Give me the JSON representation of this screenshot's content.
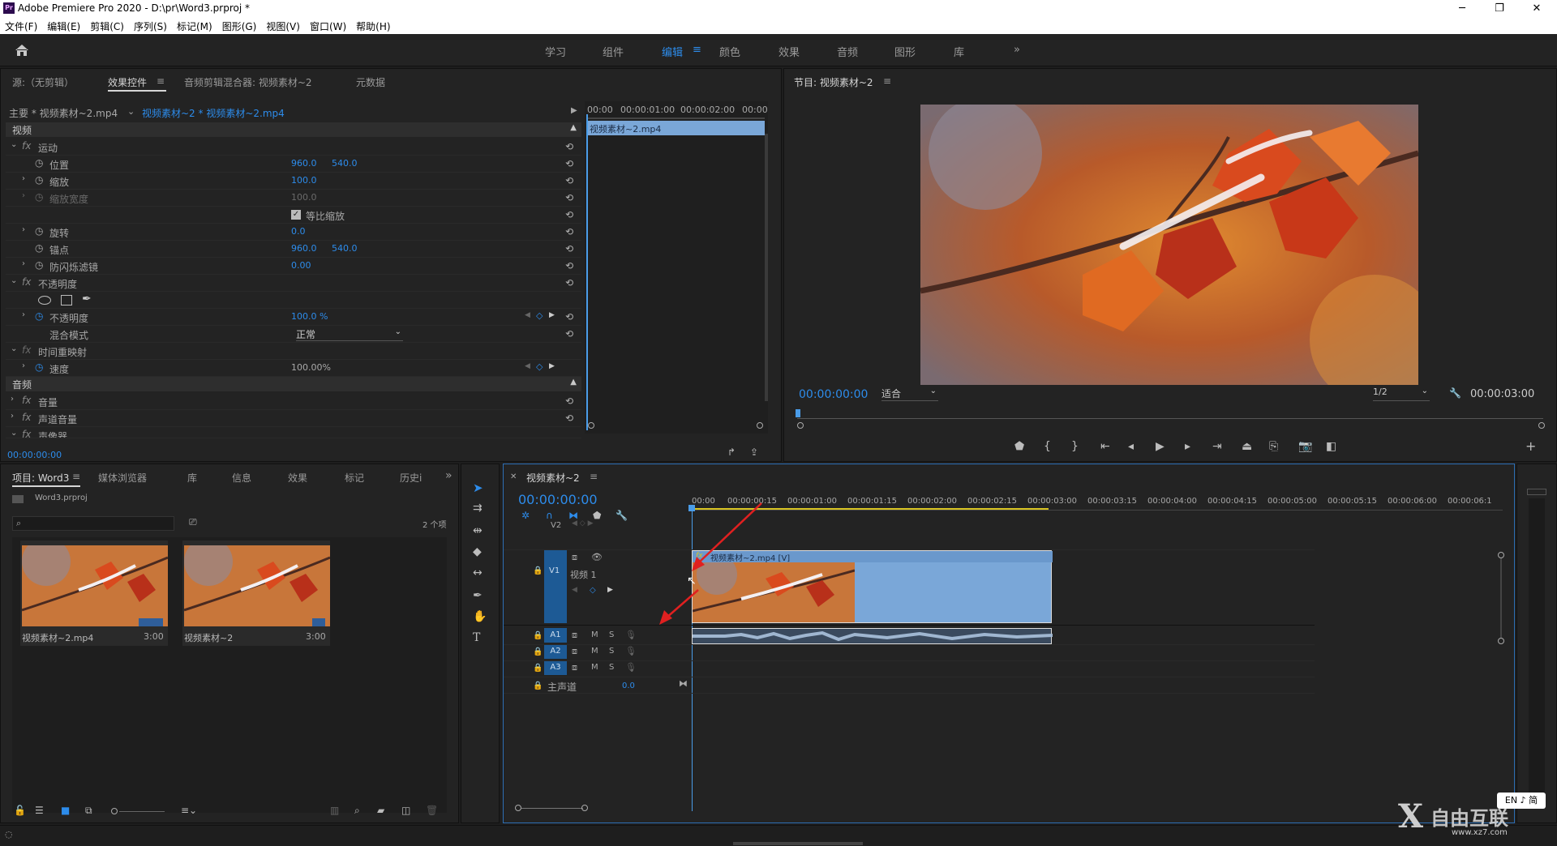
{
  "window": {
    "logo": "Pr",
    "title": "Adobe Premiere Pro 2020 - D:\\pr\\Word3.prproj *",
    "min": "─",
    "max": "❐",
    "close": "✕"
  },
  "menu": [
    "文件(F)",
    "编辑(E)",
    "剪辑(C)",
    "序列(S)",
    "标记(M)",
    "图形(G)",
    "视图(V)",
    "窗口(W)",
    "帮助(H)"
  ],
  "workspaces": {
    "items": [
      "学习",
      "组件",
      "编辑",
      "颜色",
      "效果",
      "音频",
      "图形",
      "库"
    ],
    "active": "编辑",
    "more": "»"
  },
  "source_panel": {
    "tabs": [
      "源:（无剪辑）",
      "效果控件",
      "音频剪辑混合器: 视频素材~2",
      "元数据"
    ],
    "active_tab": "效果控件",
    "master": "主要 * 视频素材~2.mp4",
    "clip": "视频素材~2 * 视频素材~2.mp4",
    "ruler": [
      "00:00",
      "00:00:01:00",
      "00:00:02:00",
      "00:00"
    ],
    "clip_bar": "视频素材~2.mp4",
    "video_label": "视频",
    "audio_label": "音频",
    "rows": [
      {
        "fx": "运动",
        "type": "group"
      },
      {
        "label": "位置",
        "v1": "960.0",
        "v2": "540.0"
      },
      {
        "label": "缩放",
        "v1": "100.0"
      },
      {
        "label": "缩放宽度",
        "v1": "100.0",
        "dim": true
      },
      {
        "label": "等比缩放",
        "type": "checkbox"
      },
      {
        "label": "旋转",
        "v1": "0.0"
      },
      {
        "label": "锚点",
        "v1": "960.0",
        "v2": "540.0"
      },
      {
        "label": "防闪烁滤镜",
        "v1": "0.00"
      },
      {
        "fx": "不透明度",
        "type": "group"
      },
      {
        "type": "masks"
      },
      {
        "label": "不透明度",
        "v1": "100.0 %",
        "keys": true
      },
      {
        "label": "混合模式",
        "select": "正常"
      },
      {
        "fx": "时间重映射",
        "type": "group",
        "dim": true
      },
      {
        "label": "速度",
        "v1": "100.00%",
        "keys": true
      }
    ],
    "audio_rows": [
      "音量",
      "声道音量",
      "声像器"
    ],
    "timecode": "00:00:00:00"
  },
  "program": {
    "title": "节目: 视频素材~2",
    "menu": "≡",
    "timecode": "00:00:00:00",
    "fit": "适合",
    "quality": "1/2",
    "duration": "00:00:03:00"
  },
  "project": {
    "tabs": [
      "项目: Word3",
      "媒体浏览器",
      "库",
      "信息",
      "效果",
      "标记",
      "历史i"
    ],
    "active_tab": "项目: Word3",
    "file": "Word3.prproj",
    "count": "2 个项",
    "items": [
      {
        "name": "视频素材~2.mp4",
        "dur": "3:00"
      },
      {
        "name": "视频素材~2",
        "dur": "3:00"
      }
    ]
  },
  "timeline": {
    "title": "视频素材~2",
    "timecode": "00:00:00:00",
    "ruler": [
      "00:00",
      "00:00:00:15",
      "00:00:01:00",
      "00:00:01:15",
      "00:00:02:00",
      "00:00:02:15",
      "00:00:03:00",
      "00:00:03:15",
      "00:00:04:00",
      "00:00:04:15",
      "00:00:05:00",
      "00:00:05:15",
      "00:00:06:00",
      "00:00:06:1"
    ],
    "tracks": {
      "v2": "V2",
      "v1": "V1",
      "v1_name": "视频 1",
      "a1": "A1",
      "a2": "A2",
      "a3": "A3",
      "master": "主声道",
      "master_val": "0.0",
      "m": "M",
      "s": "S"
    },
    "clip_label": "视频素材~2.mp4 [V]"
  },
  "ime": "EN ♪ 简",
  "watermark": {
    "brand": "自由互联",
    "url": "www.xz7.com"
  },
  "colors": {
    "accent": "#2d8ceb",
    "clip": "#7aa7d8",
    "track_active": "#1d5a95",
    "playhead": "#4a9ce8"
  }
}
